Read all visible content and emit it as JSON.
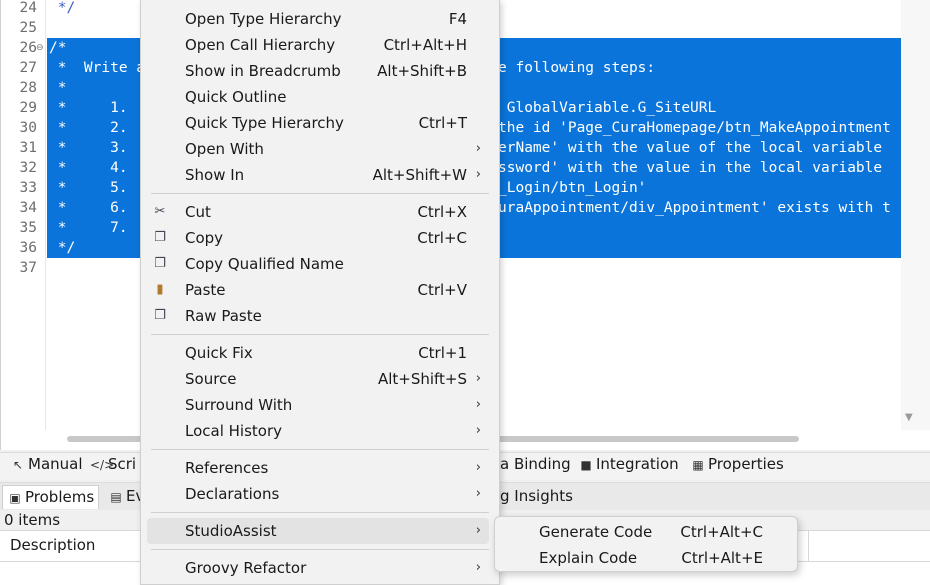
{
  "editor": {
    "lines": [
      {
        "no": "24",
        "text": " */",
        "fold": ""
      },
      {
        "no": "25",
        "text": "",
        "fold": ""
      },
      {
        "no": "26",
        "text": "/*",
        "fold": "⊖"
      },
      {
        "no": "27",
        "text": " *  Write a",
        "fold": ""
      },
      {
        "no": "28",
        "text": " *",
        "fold": ""
      },
      {
        "no": "29",
        "text": " *     1.",
        "fold": ""
      },
      {
        "no": "30",
        "text": " *     2.",
        "fold": ""
      },
      {
        "no": "31",
        "text": " *     3.",
        "fold": ""
      },
      {
        "no": "32",
        "text": " *     4.",
        "fold": ""
      },
      {
        "no": "33",
        "text": " *     5.",
        "fold": ""
      },
      {
        "no": "34",
        "text": " *     6.",
        "fold": ""
      },
      {
        "no": "35",
        "text": " *     7.",
        "fold": ""
      },
      {
        "no": "36",
        "text": " */",
        "fold": ""
      },
      {
        "no": "37",
        "text": "",
        "fold": ""
      }
    ],
    "right_fragments": [
      "e following steps:",
      "",
      " GlobalVariable.G_SiteURL",
      "the id 'Page_CuraHomepage/btn_MakeAppointment",
      "erName' with the value of the local variable",
      "ssword' with the value in the local variable",
      "_Login/btn_Login'",
      "uraAppointment/div_Appointment' exists with t"
    ]
  },
  "tabs_row1": {
    "manual": "Manual",
    "script": "Scri",
    "data_binding": "a Binding",
    "integration": "Integration",
    "properties": "Properties"
  },
  "tabs_row2": {
    "problems": "Problems",
    "events": "Ev",
    "insights": "g Insights"
  },
  "problems": {
    "count": "0 items",
    "col_description": "Description"
  },
  "menu": {
    "open_type_hierarchy": {
      "label": "Open Type Hierarchy",
      "shortcut": "F4"
    },
    "open_call_hierarchy": {
      "label": "Open Call Hierarchy",
      "shortcut": "Ctrl+Alt+H"
    },
    "show_in_breadcrumb": {
      "label": "Show in Breadcrumb",
      "shortcut": "Alt+Shift+B"
    },
    "quick_outline": {
      "label": "Quick Outline",
      "shortcut": ""
    },
    "quick_type_hierarchy": {
      "label": "Quick Type Hierarchy",
      "shortcut": "Ctrl+T"
    },
    "open_with": {
      "label": "Open With",
      "shortcut": ""
    },
    "show_in": {
      "label": "Show In",
      "shortcut": "Alt+Shift+W"
    },
    "cut": {
      "label": "Cut",
      "shortcut": "Ctrl+X"
    },
    "copy": {
      "label": "Copy",
      "shortcut": "Ctrl+C"
    },
    "copy_qualified_name": {
      "label": "Copy Qualified Name",
      "shortcut": ""
    },
    "paste": {
      "label": "Paste",
      "shortcut": "Ctrl+V"
    },
    "raw_paste": {
      "label": "Raw Paste",
      "shortcut": ""
    },
    "quick_fix": {
      "label": "Quick Fix",
      "shortcut": "Ctrl+1"
    },
    "source": {
      "label": "Source",
      "shortcut": "Alt+Shift+S"
    },
    "surround_with": {
      "label": "Surround With",
      "shortcut": ""
    },
    "local_history": {
      "label": "Local History",
      "shortcut": ""
    },
    "references": {
      "label": "References",
      "shortcut": ""
    },
    "declarations": {
      "label": "Declarations",
      "shortcut": ""
    },
    "studio_assist": {
      "label": "StudioAssist",
      "shortcut": ""
    },
    "groovy_refactor": {
      "label": "Groovy Refactor",
      "shortcut": ""
    }
  },
  "submenu": {
    "generate_code": {
      "label": "Generate Code",
      "shortcut": "Ctrl+Alt+C"
    },
    "explain_code": {
      "label": "Explain Code",
      "shortcut": "Ctrl+Alt+E"
    }
  },
  "colors": {
    "selection": "#0a74da",
    "comment": "#3f5fbf",
    "menu_bg": "#f2f2f2",
    "menu_highlight": "#e3e3e3"
  }
}
